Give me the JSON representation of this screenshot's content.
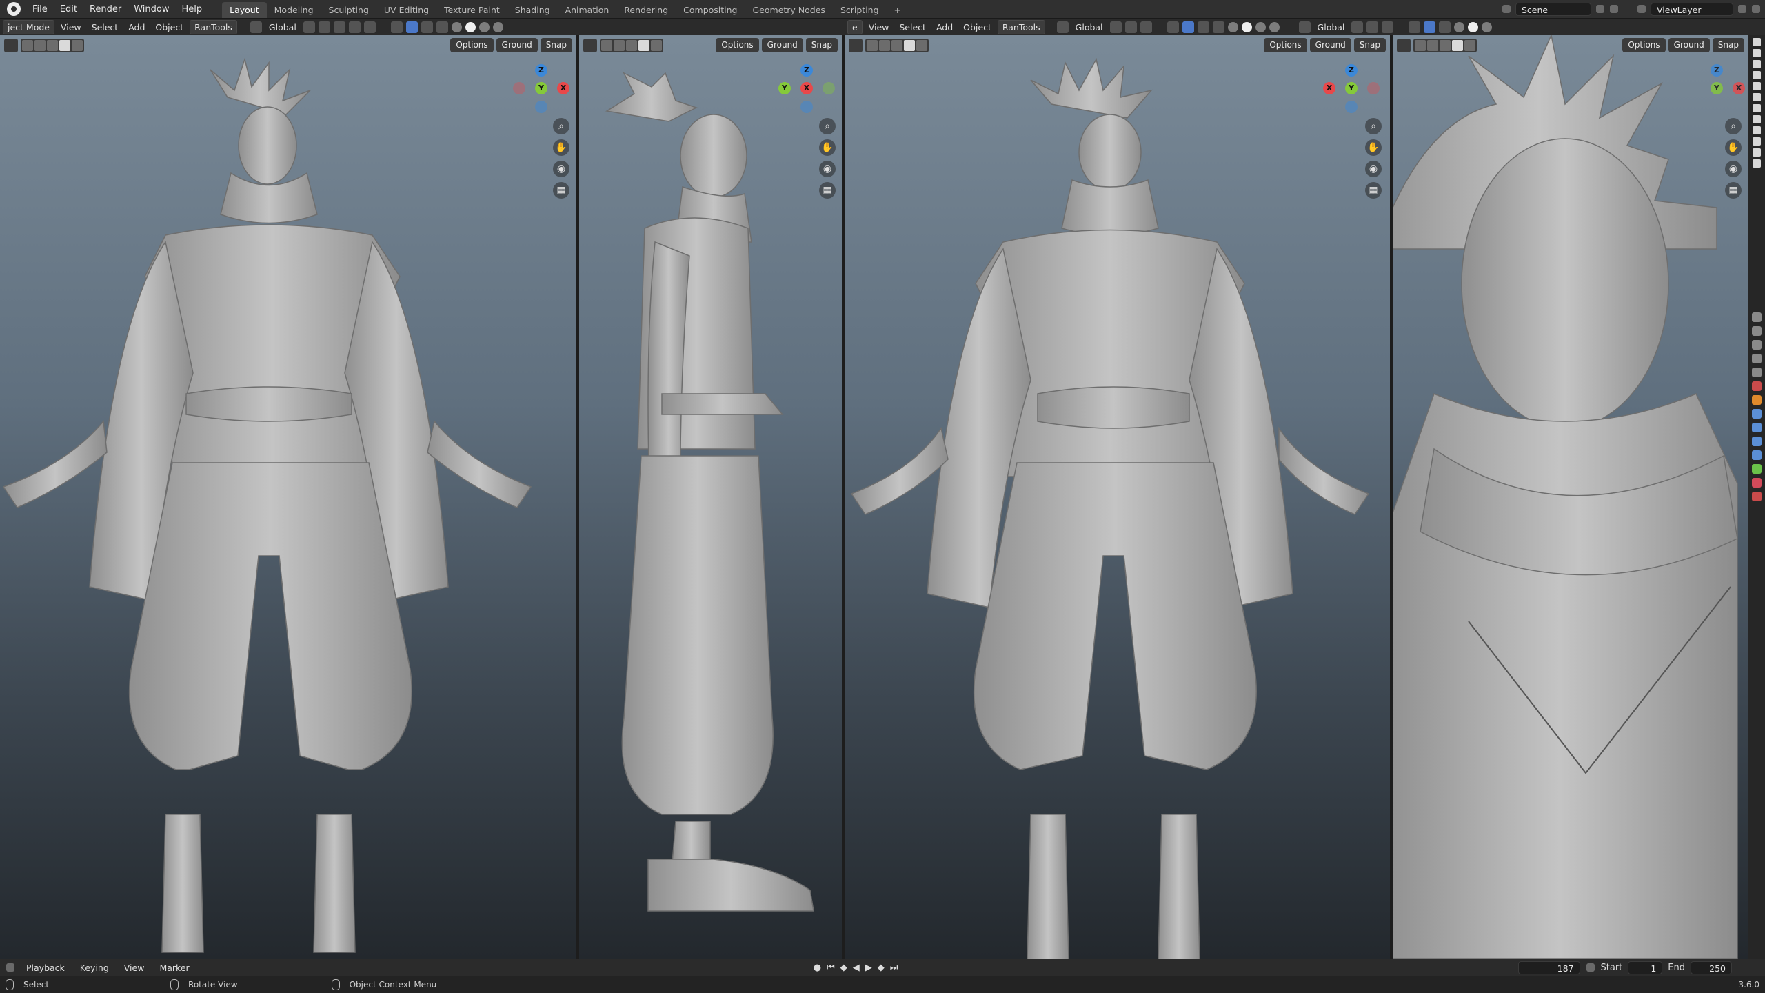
{
  "topbar": {
    "menus": [
      "File",
      "Edit",
      "Render",
      "Window",
      "Help"
    ],
    "workspaces": [
      "Layout",
      "Modeling",
      "Sculpting",
      "UV Editing",
      "Texture Paint",
      "Shading",
      "Animation",
      "Rendering",
      "Compositing",
      "Geometry Nodes",
      "Scripting"
    ],
    "active_workspace": "Layout",
    "add_tab_label": "+",
    "scene_label": "Scene",
    "view_layer_label": "ViewLayer"
  },
  "viewport_header": {
    "mode_label": "ject Mode",
    "menus": [
      "View",
      "Select",
      "Add",
      "Object",
      "RanTools"
    ],
    "transform_label": "Global",
    "mode_label_3": "e"
  },
  "viewport_overlay": {
    "options_label": "Options",
    "ground_label": "Ground",
    "snap_label": "Snap"
  },
  "gizmo": {
    "z": "Z",
    "y": "Y",
    "x": "X",
    "colors": {
      "x": "#e8484a",
      "y": "#85c93a",
      "z": "#3c88d8"
    }
  },
  "timeline": {
    "menus": [
      "Playback",
      "Keying",
      "View",
      "Marker"
    ],
    "current_frame": "187",
    "start_label": "Start",
    "start_value": "1",
    "end_label": "End",
    "end_value": "250"
  },
  "statusbar": {
    "select": "Select",
    "rotate_view": "Rotate View",
    "context_menu": "Object Context Menu",
    "version": "3.6.0"
  }
}
